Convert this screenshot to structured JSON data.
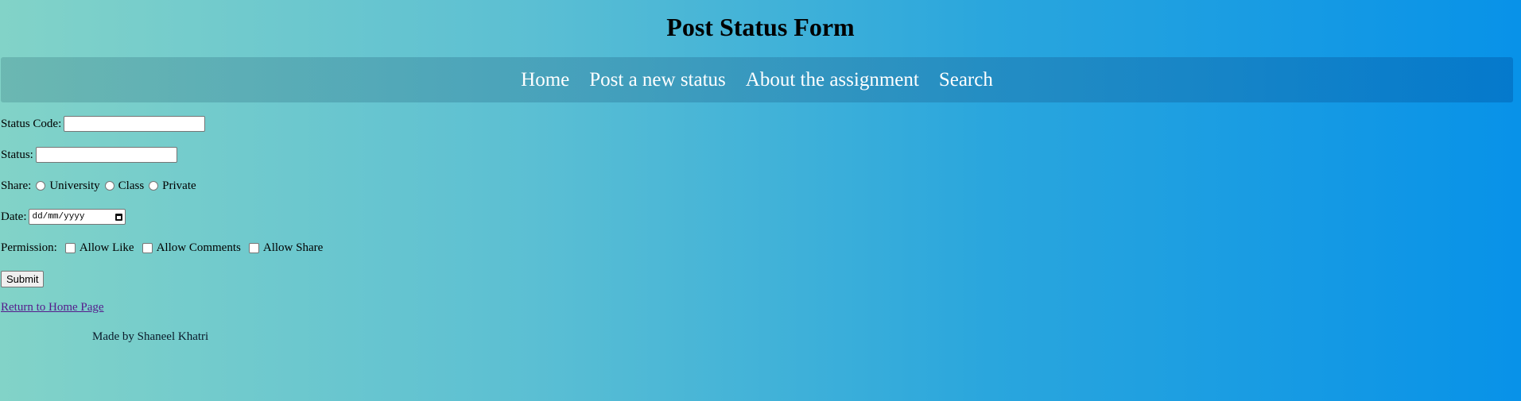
{
  "page": {
    "title": "Post Status Form"
  },
  "nav": {
    "items": [
      {
        "label": "Home"
      },
      {
        "label": "Post a new status"
      },
      {
        "label": "About the assignment"
      },
      {
        "label": "Search"
      }
    ]
  },
  "form": {
    "status_code": {
      "label": "Status Code:",
      "value": ""
    },
    "status": {
      "label": "Status:",
      "value": ""
    },
    "share": {
      "label": "Share:",
      "options": [
        "University",
        "Class",
        "Private"
      ],
      "selected": null
    },
    "date": {
      "label": "Date:",
      "placeholder": "dd/mm/yyyy",
      "icon": "calendar-icon"
    },
    "permission": {
      "label": "Permission:",
      "options": [
        {
          "label": "Allow Like",
          "checked": false
        },
        {
          "label": "Allow Comments",
          "checked": false
        },
        {
          "label": "Allow Share",
          "checked": false
        }
      ]
    },
    "submit_label": "Submit"
  },
  "links": {
    "return_home": "Return to Home Page"
  },
  "footer": {
    "text": "Made by Shaneel Khatri"
  },
  "colors": {
    "gradient_start": "#82d3c8",
    "gradient_end": "#0892e8",
    "nav_text": "#ffffff",
    "visited_link": "#551a8b"
  }
}
